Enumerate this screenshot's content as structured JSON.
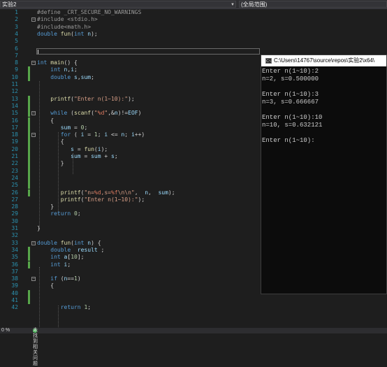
{
  "toolbar": {
    "project_combo": "实验2",
    "scope_combo": "(全局范围)"
  },
  "editor": {
    "lines": [
      {
        "n": "1",
        "t": [
          [
            "pp",
            "#define _CRT_SECURE_NO_WARNINGS"
          ]
        ]
      },
      {
        "n": "2",
        "t": [
          [
            "pp",
            "#include <stdio.h>"
          ]
        ]
      },
      {
        "n": "3",
        "t": [
          [
            "pp",
            "#include<math.h>"
          ]
        ]
      },
      {
        "n": "4",
        "t": [
          [
            "kw",
            "double "
          ],
          [
            "fn",
            "fun"
          ],
          [
            "txt",
            "("
          ],
          [
            "kw",
            "int "
          ],
          [
            "var",
            "n"
          ],
          [
            "txt",
            ");"
          ]
        ]
      },
      {
        "n": "5",
        "t": []
      },
      {
        "n": "6",
        "t": []
      },
      {
        "n": "7",
        "t": []
      },
      {
        "n": "8",
        "t": [
          [
            "kw",
            "int "
          ],
          [
            "fn",
            "main"
          ],
          [
            "txt",
            "() {"
          ]
        ]
      },
      {
        "n": "9",
        "t": [
          [
            "txt",
            "    "
          ],
          [
            "kw",
            "int "
          ],
          [
            "var",
            "n"
          ],
          [
            "txt",
            ","
          ],
          [
            "var",
            "i"
          ],
          [
            "txt",
            ";"
          ]
        ]
      },
      {
        "n": "10",
        "t": [
          [
            "txt",
            "    "
          ],
          [
            "kw",
            "double "
          ],
          [
            "var",
            "s"
          ],
          [
            "txt",
            ","
          ],
          [
            "var",
            "sum"
          ],
          [
            "txt",
            ";"
          ]
        ]
      },
      {
        "n": "11",
        "t": []
      },
      {
        "n": "12",
        "t": []
      },
      {
        "n": "13",
        "t": [
          [
            "txt",
            "    "
          ],
          [
            "fn",
            "printf"
          ],
          [
            "txt",
            "("
          ],
          [
            "str",
            "\"Enter n(1~10):\""
          ],
          [
            "txt",
            ");"
          ]
        ]
      },
      {
        "n": "14",
        "t": []
      },
      {
        "n": "15",
        "t": [
          [
            "txt",
            "    "
          ],
          [
            "kw",
            "while "
          ],
          [
            "txt",
            "("
          ],
          [
            "fn",
            "scanf"
          ],
          [
            "txt",
            "("
          ],
          [
            "str",
            "\""
          ],
          [
            "fmt",
            "%d"
          ],
          [
            "str",
            "\""
          ],
          [
            "txt",
            ",&"
          ],
          [
            "var",
            "n"
          ],
          [
            "txt",
            ")!="
          ],
          [
            "var",
            "EOF"
          ],
          [
            "txt",
            ")"
          ]
        ]
      },
      {
        "n": "16",
        "t": [
          [
            "txt",
            "    {"
          ]
        ]
      },
      {
        "n": "17",
        "t": [
          [
            "txt",
            "       "
          ],
          [
            "var",
            "sum"
          ],
          [
            "txt",
            " = "
          ],
          [
            "num",
            "0"
          ],
          [
            "txt",
            ";"
          ]
        ]
      },
      {
        "n": "18",
        "t": [
          [
            "txt",
            "       "
          ],
          [
            "kw",
            "for "
          ],
          [
            "txt",
            "( "
          ],
          [
            "var",
            "i"
          ],
          [
            "txt",
            " = "
          ],
          [
            "num",
            "1"
          ],
          [
            "txt",
            "; "
          ],
          [
            "var",
            "i"
          ],
          [
            "txt",
            " <= "
          ],
          [
            "var",
            "n"
          ],
          [
            "txt",
            "; "
          ],
          [
            "var",
            "i"
          ],
          [
            "txt",
            "++)"
          ]
        ]
      },
      {
        "n": "19",
        "t": [
          [
            "txt",
            "       {"
          ]
        ]
      },
      {
        "n": "20",
        "t": [
          [
            "txt",
            "          "
          ],
          [
            "var",
            "s"
          ],
          [
            "txt",
            " = "
          ],
          [
            "fn",
            "fun"
          ],
          [
            "txt",
            "("
          ],
          [
            "var",
            "i"
          ],
          [
            "txt",
            ");"
          ]
        ]
      },
      {
        "n": "21",
        "t": [
          [
            "txt",
            "          "
          ],
          [
            "var",
            "sum"
          ],
          [
            "txt",
            " = "
          ],
          [
            "var",
            "sum"
          ],
          [
            "txt",
            " + "
          ],
          [
            "var",
            "s"
          ],
          [
            "txt",
            ";"
          ]
        ]
      },
      {
        "n": "22",
        "t": [
          [
            "txt",
            "       }"
          ]
        ]
      },
      {
        "n": "23",
        "t": []
      },
      {
        "n": "24",
        "t": []
      },
      {
        "n": "25",
        "t": []
      },
      {
        "n": "26",
        "t": [
          [
            "txt",
            "       "
          ],
          [
            "fn",
            "printf"
          ],
          [
            "txt",
            "("
          ],
          [
            "str",
            "\"n="
          ],
          [
            "fmt",
            "%d"
          ],
          [
            "str",
            ",s="
          ],
          [
            "fmt",
            "%f"
          ],
          [
            "str",
            "\\n\\n\""
          ],
          [
            "txt",
            ",  "
          ],
          [
            "var",
            "n"
          ],
          [
            "txt",
            ",  "
          ],
          [
            "var",
            "sum"
          ],
          [
            "txt",
            ");"
          ]
        ]
      },
      {
        "n": "27",
        "t": [
          [
            "txt",
            "       "
          ],
          [
            "fn",
            "printf"
          ],
          [
            "txt",
            "("
          ],
          [
            "str",
            "\"Enter n(1~10):\""
          ],
          [
            "txt",
            ");"
          ]
        ]
      },
      {
        "n": "28",
        "t": [
          [
            "txt",
            "    }"
          ]
        ]
      },
      {
        "n": "29",
        "t": [
          [
            "txt",
            "    "
          ],
          [
            "kw",
            "return "
          ],
          [
            "num",
            "0"
          ],
          [
            "txt",
            ";"
          ]
        ]
      },
      {
        "n": "30",
        "t": []
      },
      {
        "n": "31",
        "t": [
          [
            "txt",
            "}"
          ]
        ]
      },
      {
        "n": "32",
        "t": []
      },
      {
        "n": "33",
        "t": [
          [
            "kw",
            "double "
          ],
          [
            "fn",
            "fun"
          ],
          [
            "txt",
            "("
          ],
          [
            "kw",
            "int "
          ],
          [
            "var",
            "n"
          ],
          [
            "txt",
            ") {"
          ]
        ]
      },
      {
        "n": "34",
        "t": [
          [
            "txt",
            "    "
          ],
          [
            "kw",
            "double  "
          ],
          [
            "var",
            "result"
          ],
          [
            "txt",
            " ;"
          ]
        ]
      },
      {
        "n": "35",
        "t": [
          [
            "txt",
            "    "
          ],
          [
            "kw",
            "int "
          ],
          [
            "var",
            "a"
          ],
          [
            "txt",
            "["
          ],
          [
            "num",
            "10"
          ],
          [
            "txt",
            "];"
          ]
        ]
      },
      {
        "n": "36",
        "t": [
          [
            "txt",
            "    "
          ],
          [
            "kw",
            "int "
          ],
          [
            "var",
            "i"
          ],
          [
            "txt",
            ";"
          ]
        ]
      },
      {
        "n": "37",
        "t": []
      },
      {
        "n": "38",
        "t": [
          [
            "txt",
            "    "
          ],
          [
            "kw",
            "if "
          ],
          [
            "txt",
            "("
          ],
          [
            "var",
            "n"
          ],
          [
            "txt",
            "=="
          ],
          [
            "num",
            "1"
          ],
          [
            "txt",
            ")"
          ]
        ]
      },
      {
        "n": "39",
        "t": [
          [
            "txt",
            "    {"
          ]
        ]
      },
      {
        "n": "40",
        "t": []
      },
      {
        "n": "41",
        "t": []
      },
      {
        "n": "42",
        "t": [
          [
            "txt",
            "       "
          ],
          [
            "kw",
            "return "
          ],
          [
            "num",
            "1"
          ],
          [
            "txt",
            ";"
          ]
        ]
      }
    ]
  },
  "console": {
    "title": "C:\\Users\\14767\\source\\repos\\实验2\\x64\\",
    "icon_label": "C:\\",
    "output": [
      "Enter n(1~10):2",
      "n=2, s=0.500000",
      "",
      "Enter n(1~10):3",
      "n=3, s=0.666667",
      "",
      "Enter n(1~10):10",
      "n=10, s=0.632121",
      "",
      "Enter n(1~10):"
    ]
  },
  "status": {
    "zoom": "0 %",
    "issues": "未找到相关问题"
  },
  "colors": {
    "background": "#1e1e1e",
    "line_number": "#2b91af",
    "keyword": "#569cd6",
    "string": "#d69d85",
    "change_bar": "#57a64a",
    "console_bg": "#0c0c0c"
  }
}
